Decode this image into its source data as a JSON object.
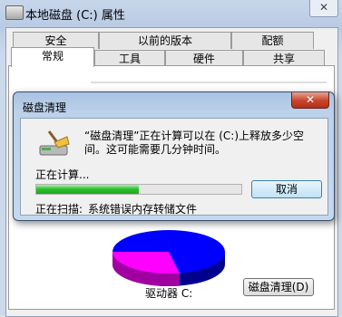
{
  "props": {
    "title": "本地磁盘 (C:) 属性",
    "close_symbol": "✕",
    "tabs_back": [
      "安全",
      "以前的版本",
      "配额"
    ],
    "tabs_front": [
      "常规",
      "工具",
      "硬件",
      "共享"
    ],
    "drive_label": "驱动器 C:",
    "cleanup_button": "磁盘清理(D)",
    "pie_colors": {
      "used": "#0000ff",
      "free": "#ff00ff"
    }
  },
  "dialog": {
    "title": "磁盘清理",
    "close_symbol": "✕",
    "message": "“磁盘清理”正在计算可以在 (C:)上释放多少空间。这可能需要几分钟时间。",
    "status": "正在计算...",
    "progress": 0.5,
    "cancel_button": "取消",
    "scanning_label": "正在扫描:",
    "scanning_item": "系统错误内存转储文件"
  }
}
